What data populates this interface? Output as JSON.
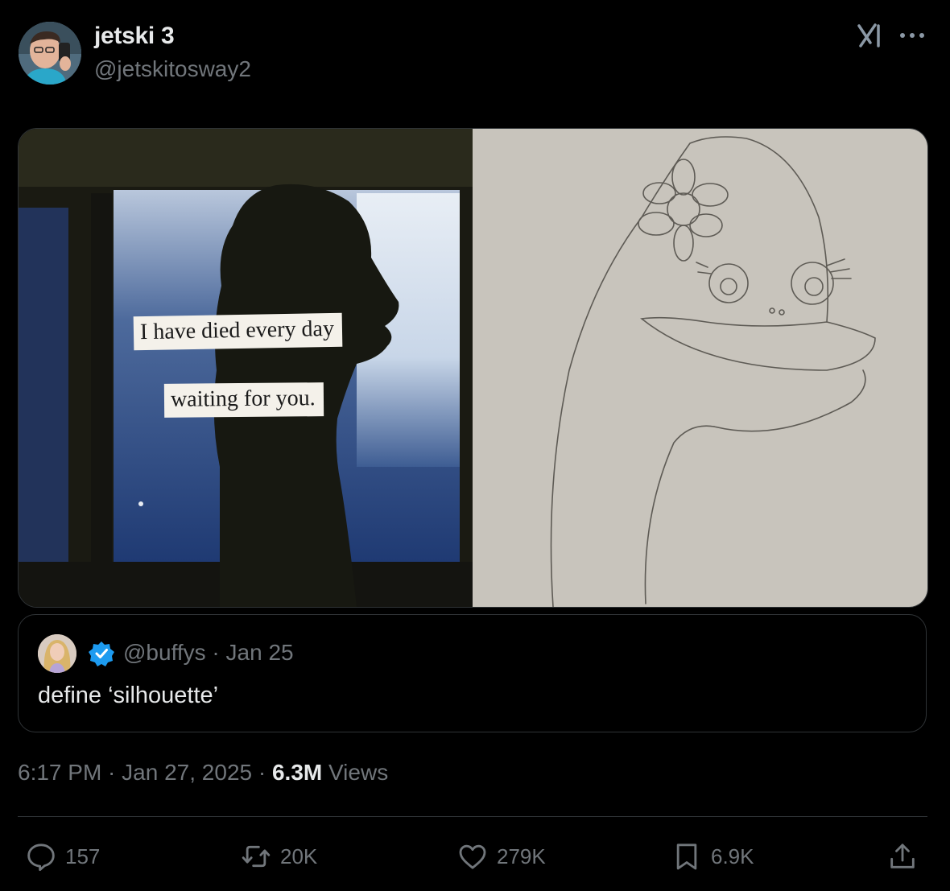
{
  "post": {
    "author": {
      "display_name": "jetski 3",
      "handle": "@jetskitosway2"
    },
    "media": {
      "caption_lines": [
        "I have died every day",
        "waiting for you."
      ]
    },
    "quoted_post": {
      "handle": "@buffys",
      "separator": " · ",
      "date": "Jan 25",
      "text": "define ‘silhouette’"
    },
    "meta": {
      "time": "6:17 PM",
      "separator": " · ",
      "date": "Jan 27, 2025",
      "views_count": "6.3M",
      "views_label": " Views"
    },
    "actions": {
      "replies": "157",
      "reposts": "20K",
      "likes": "279K",
      "bookmarks": "6.9K"
    }
  },
  "icons": {
    "header": [
      "grok-icon",
      "more-icon"
    ],
    "actions": [
      "reply-icon",
      "repost-icon",
      "like-icon",
      "bookmark-icon",
      "share-icon"
    ],
    "badge": "verified-icon"
  },
  "colors": {
    "background": "#000000",
    "primary_text": "#e7e9ea",
    "secondary_text": "#71767b",
    "border": "#2f3336",
    "verified": "#1d9bf0"
  }
}
